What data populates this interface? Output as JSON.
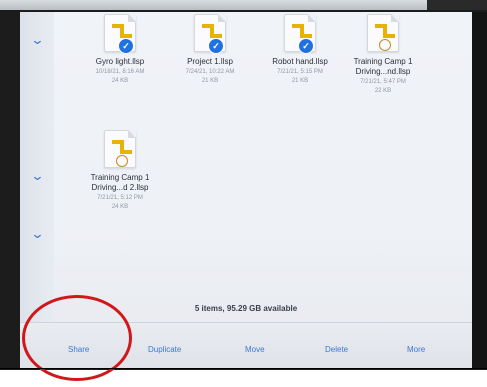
{
  "files": [
    {
      "name": "Gyro light.llsp",
      "date": "10/18/21, 8:16 AM",
      "size": "24 KB",
      "icon": "llsp-file-icon",
      "badge": "upload-badge"
    },
    {
      "name": "Project 1.llsp",
      "date": "7/24/21, 10:22 AM",
      "size": "21 KB",
      "icon": "llsp-file-icon",
      "badge": "upload-badge"
    },
    {
      "name": "Robot hand.llsp",
      "date": "7/21/21, 5:15 PM",
      "size": "21 KB",
      "icon": "llsp-file-icon",
      "badge": "upload-badge"
    },
    {
      "name_line1": "Training Camp 1",
      "name_line2": "Driving...nd.llsp",
      "date": "7/21/21, 5:47 PM",
      "size": "22 KB",
      "icon": "llsp-file-icon"
    },
    {
      "name_line1": "Training Camp 1",
      "name_line2": "Driving...d 2.llsp",
      "date": "7/21/21, 5:12 PM",
      "size": "24 KB",
      "icon": "llsp-file-icon"
    }
  ],
  "status": "5 items, 95.29 GB available",
  "toolbar": {
    "share": "Share",
    "duplicate": "Duplicate",
    "move": "Move",
    "delete": "Delete",
    "more": "More"
  },
  "sidebar_chevrons": [
    "chevron-down-icon",
    "chevron-down-icon",
    "chevron-down-icon"
  ],
  "colors": {
    "accent": "#3b78d6",
    "badge": "#1f72e0",
    "file_icon_yellow": "#e6b400",
    "annotation_red": "#d0181b"
  }
}
